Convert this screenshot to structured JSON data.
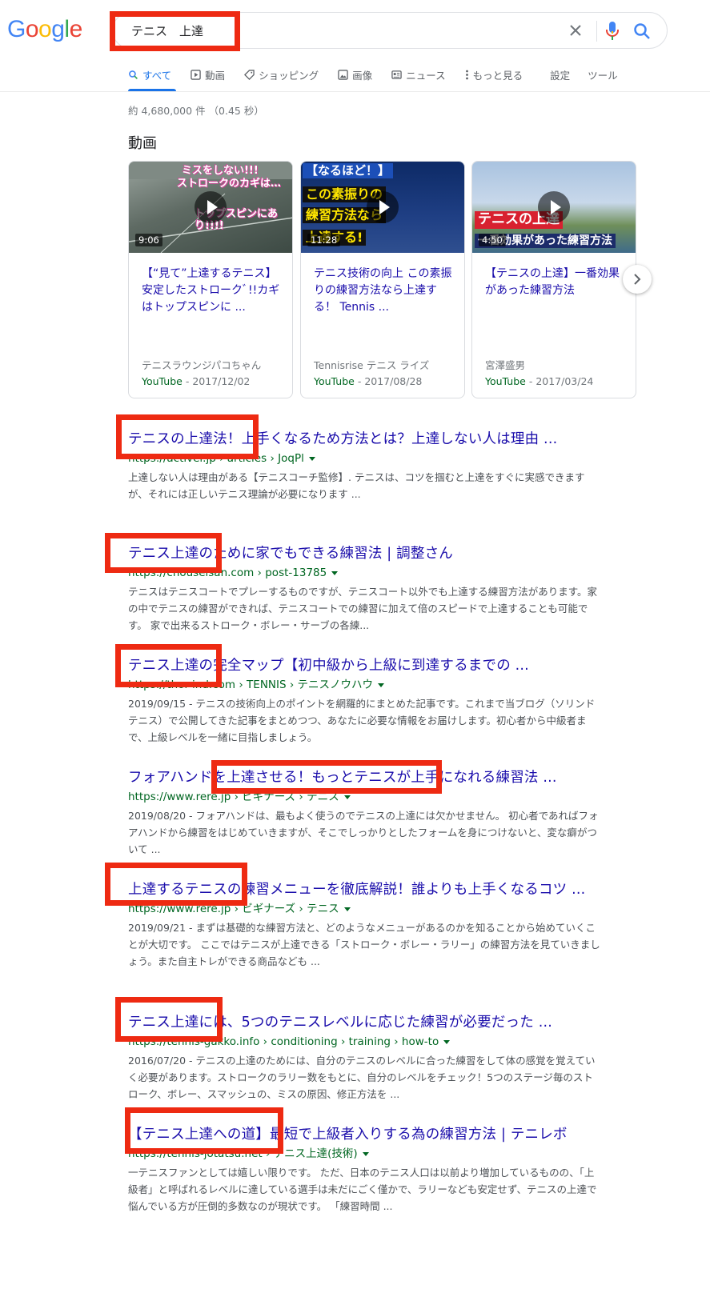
{
  "header": {
    "logo": [
      "G",
      "o",
      "o",
      "g",
      "l",
      "e"
    ],
    "logo_colors": [
      "#4285f4",
      "#ea4335",
      "#fbbc05",
      "#4285f4",
      "#34a853",
      "#ea4335"
    ],
    "query": "テニス　上達"
  },
  "tabs": [
    {
      "label": "すべて",
      "icon": "search-icon",
      "active": true
    },
    {
      "label": "動画",
      "icon": "video-icon"
    },
    {
      "label": "ショッピング",
      "icon": "tag-icon"
    },
    {
      "label": "画像",
      "icon": "image-icon"
    },
    {
      "label": "ニュース",
      "icon": "news-icon"
    },
    {
      "label": "もっと見る",
      "icon": "more-vert-icon"
    },
    {
      "label": "設定"
    },
    {
      "label": "ツール"
    }
  ],
  "stats": "約 4,680,000 件 （0.45 秒）",
  "videos_section": {
    "title": "動画",
    "cards": [
      {
        "title": "【“見て”上達するテニス】安定したストロークﾞ!!カギはトップスピンに ...",
        "channel": "テニスラウンジパコちゃん",
        "source": "YouTube",
        "date": "2017/12/02",
        "duration": "9:06",
        "overlay": [
          "ミスをしない!!!",
          "ストロークのカギは…",
          "トップスピンにあり!!!!"
        ],
        "thumb_color": "#6f7b73"
      },
      {
        "title": "テニス技術の向上 この素振りの練習方法なら上達する！ Tennis ...",
        "channel": "Tennisrise テニス ライズ",
        "source": "YouTube",
        "date": "2017/08/28",
        "duration": "11:28",
        "overlay": [
          "【なるほど！】",
          "この素振りの",
          "練習方法なら",
          "上達する!"
        ],
        "thumb_color": "#1f3569"
      },
      {
        "title": "【テニスの上達】一番効果があった練習方法",
        "channel": "宮澤盛男",
        "source": "YouTube",
        "date": "2017/03/24",
        "duration": "4:50",
        "overlay": [
          "テニスの上達",
          "一番効果があった練習方法"
        ],
        "thumb_color": "#8aa7c9"
      }
    ]
  },
  "results": [
    {
      "title": "テニスの上達法！上手くなるため方法とは？上達しない人は理由 ...",
      "url": "https://activel.jp › articles › JoqPl",
      "snippet": "上達しない人は理由がある【テニスコーチ監修】. テニスは、コツを掴むと上達をすぐに実感できますが、それには正しいテニス理論が必要になります ..."
    },
    {
      "title": "テニス上達のために家でもできる練習法 | 調整さん",
      "url": "https://chouseisan.com › post-13785",
      "snippet": "テニスはテニスコートでプレーするものですが、テニスコート以外でも上達する練習方法があります。家の中でテニスの練習ができれば、テニスコートでの練習に加えて倍のスピードで上達することも可能です。 家で出来るストローク・ボレー・サーブの各練..."
    },
    {
      "title": "テニス上達の完全マップ【初中級から上級に到達するまでの ...",
      "url": "https://thor-ind.com › TENNIS › テニスノウハウ",
      "snippet": "2019/09/15 - テニスの技術向上のポイントを網羅的にまとめた記事です。これまで当ブログ（ソリンドテニス）で公開してきた記事をまとめつつ、あなたに必要な情報をお届けします。初心者から中級者まで、上級レベルを一緒に目指しましょう。"
    },
    {
      "title": "フォアハンドを上達させる！もっとテニスが上手になれる練習法 ...",
      "url": "https://www.rere.jp › ビギナーズ › テニス",
      "snippet": "2019/08/20 - フォアハンドは、最もよく使うのでテニスの上達には欠かせません。 初心者であればフォアハンドから練習をはじめていきますが、そこでしっかりとしたフォームを身につけないと、変な癖がついて ..."
    },
    {
      "title": "上達するテニスの練習メニューを徹底解説！誰よりも上手くなるコツ ...",
      "url": "https://www.rere.jp › ビギナーズ › テニス",
      "snippet": "2019/09/21 - まずは基礎的な練習方法と、どのようなメニューがあるのかを知ることから始めていくことが大切です。 ここではテニスが上達できる「ストローク・ボレー・ラリー」の練習方法を見ていきましょう。また自主トレができる商品なども ..."
    },
    {
      "title": "テニス上達には、5つのテニスレベルに応じた練習が必要だった ...",
      "url": "https://tennis-gakko.info › conditioning › training › how-to",
      "snippet": "2016/07/20 - テニスの上達のためには、自分のテニスのレベルに合った練習をして体の感覚を覚えていく必要があります。ストロークのラリー数をもとに、自分のレベルをチェック！5つのステージ毎のストローク、ボレー、スマッシュの、ミスの原因、修正方法を ..."
    },
    {
      "title": "【テニス上達への道】最短で上級者入りする為の練習方法 | テニレボ",
      "url": "https://tennis-jotatsu.net › テニス上達(技術)",
      "snippet": "一テニスファンとしては嬉しい限りです。 ただ、日本のテニス人口は以前より増加しているものの、「上級者」と呼ばれるレベルに達している選手は未だにごく僅かで、ラリーなども安定せず、テニスの上達で悩んでいる方が圧倒的多数なのが現状です。 「練習時間 ..."
    }
  ],
  "annotation_color": "#ee2a12"
}
